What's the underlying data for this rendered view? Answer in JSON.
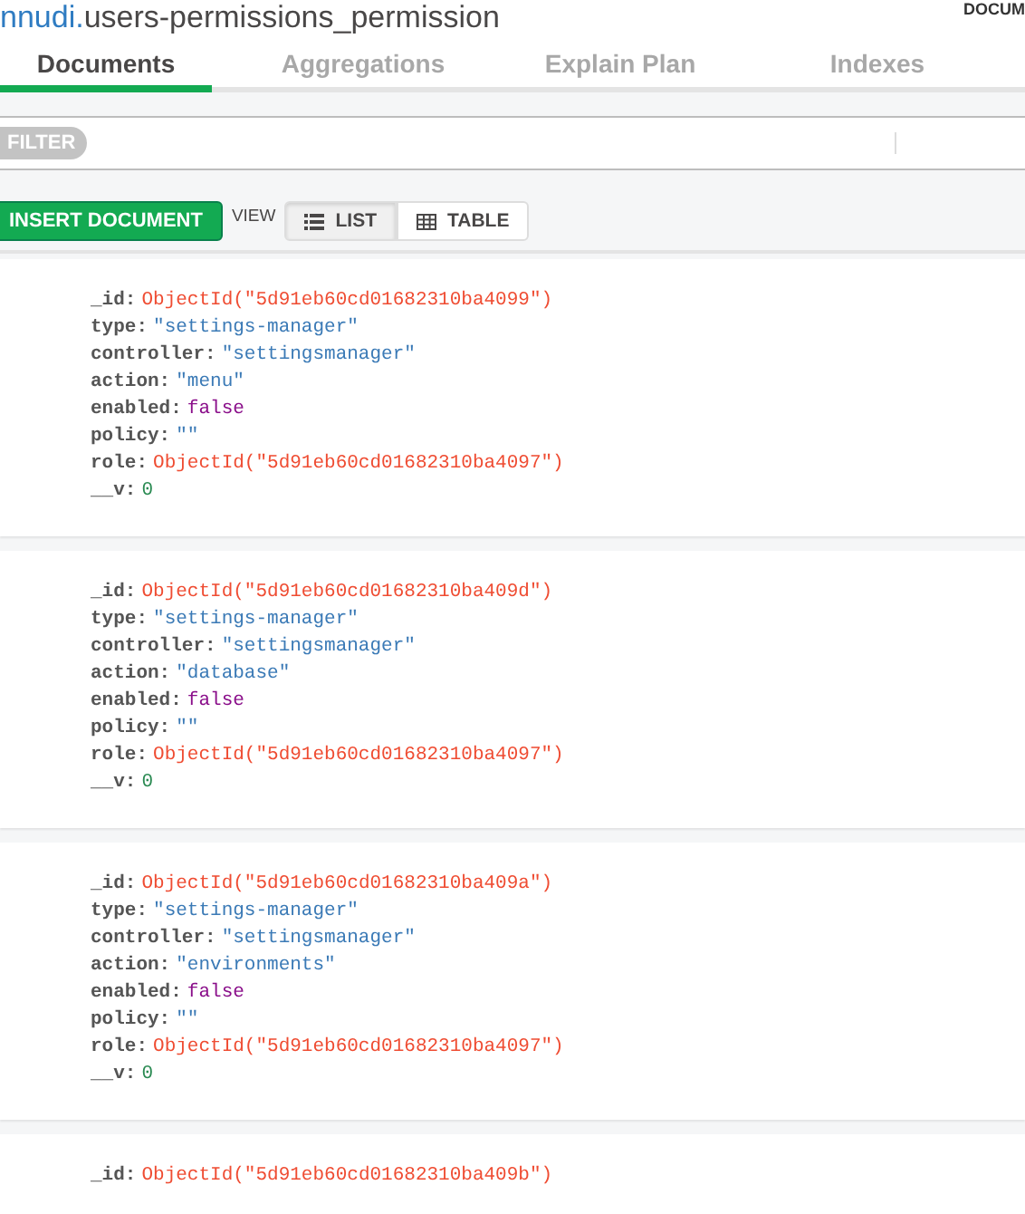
{
  "header": {
    "database": "nnudi.",
    "collection": "users-permissions_permission",
    "badge": "DOCUM"
  },
  "tabs": [
    {
      "label": "Documents",
      "selected": true
    },
    {
      "label": "Aggregations",
      "selected": false
    },
    {
      "label": "Explain Plan",
      "selected": false
    },
    {
      "label": "Indexes",
      "selected": false
    }
  ],
  "filter": {
    "label": "FILTER"
  },
  "toolbar": {
    "insert": "INSERT DOCUMENT",
    "view_label": "VIEW",
    "views": [
      {
        "label": "LIST",
        "kind": "list",
        "selected": true
      },
      {
        "label": "TABLE",
        "kind": "table",
        "selected": false
      }
    ]
  },
  "documents": [
    {
      "fields": [
        {
          "key": "_id:",
          "value": "ObjectId(\"5d91eb60cd01682310ba4099\")",
          "kind": "oid"
        },
        {
          "key": "type:",
          "value": "\"settings-manager\"",
          "kind": "string"
        },
        {
          "key": "controller:",
          "value": "\"settingsmanager\"",
          "kind": "string"
        },
        {
          "key": "action:",
          "value": "\"menu\"",
          "kind": "string"
        },
        {
          "key": "enabled:",
          "value": "false",
          "kind": "bool"
        },
        {
          "key": "policy:",
          "value": "\"\"",
          "kind": "string"
        },
        {
          "key": "role:",
          "value": "ObjectId(\"5d91eb60cd01682310ba4097\")",
          "kind": "oid"
        },
        {
          "key": "__v:",
          "value": "0",
          "kind": "number"
        }
      ]
    },
    {
      "fields": [
        {
          "key": "_id:",
          "value": "ObjectId(\"5d91eb60cd01682310ba409d\")",
          "kind": "oid"
        },
        {
          "key": "type:",
          "value": "\"settings-manager\"",
          "kind": "string"
        },
        {
          "key": "controller:",
          "value": "\"settingsmanager\"",
          "kind": "string"
        },
        {
          "key": "action:",
          "value": "\"database\"",
          "kind": "string"
        },
        {
          "key": "enabled:",
          "value": "false",
          "kind": "bool"
        },
        {
          "key": "policy:",
          "value": "\"\"",
          "kind": "string"
        },
        {
          "key": "role:",
          "value": "ObjectId(\"5d91eb60cd01682310ba4097\")",
          "kind": "oid"
        },
        {
          "key": "__v:",
          "value": "0",
          "kind": "number"
        }
      ]
    },
    {
      "fields": [
        {
          "key": "_id:",
          "value": "ObjectId(\"5d91eb60cd01682310ba409a\")",
          "kind": "oid"
        },
        {
          "key": "type:",
          "value": "\"settings-manager\"",
          "kind": "string"
        },
        {
          "key": "controller:",
          "value": "\"settingsmanager\"",
          "kind": "string"
        },
        {
          "key": "action:",
          "value": "\"environments\"",
          "kind": "string"
        },
        {
          "key": "enabled:",
          "value": "false",
          "kind": "bool"
        },
        {
          "key": "policy:",
          "value": "\"\"",
          "kind": "string"
        },
        {
          "key": "role:",
          "value": "ObjectId(\"5d91eb60cd01682310ba4097\")",
          "kind": "oid"
        },
        {
          "key": "__v:",
          "value": "0",
          "kind": "number"
        }
      ]
    },
    {
      "fields": [
        {
          "key": "_id:",
          "value": "ObjectId(\"5d91eb60cd01682310ba409b\")",
          "kind": "oid"
        }
      ]
    }
  ]
}
